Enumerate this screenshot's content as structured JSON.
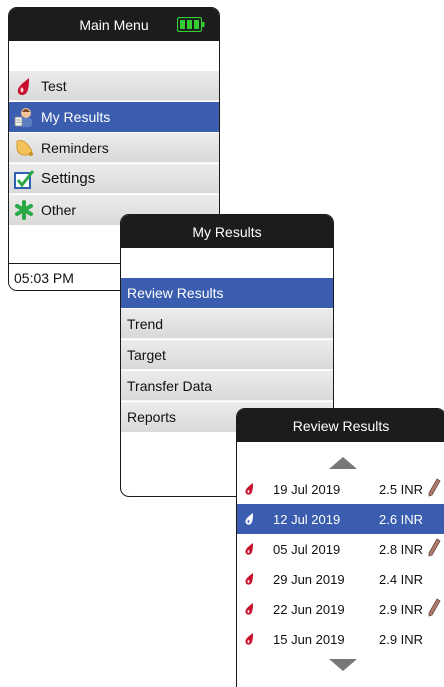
{
  "main_menu": {
    "title": "Main Menu",
    "battery_icon": "battery-full-icon",
    "items": [
      {
        "label": "Test",
        "icon": "blood-drop-icon"
      },
      {
        "label": "My Results",
        "icon": "user-results-icon"
      },
      {
        "label": "Reminders",
        "icon": "bell-icon"
      },
      {
        "label": "Settings",
        "icon": "checkbox-icon"
      },
      {
        "label": "Other",
        "icon": "star-icon"
      }
    ],
    "selected_index": 1,
    "time": "05:03 PM"
  },
  "my_results": {
    "title": "My Results",
    "items": [
      {
        "label": "Review Results"
      },
      {
        "label": "Trend"
      },
      {
        "label": "Target"
      },
      {
        "label": "Transfer Data"
      },
      {
        "label": "Reports"
      }
    ],
    "selected_index": 0
  },
  "review_results": {
    "title": "Review Results",
    "rows": [
      {
        "date": "19 Jul 2019",
        "value": "2.5 INR",
        "has_note": true
      },
      {
        "date": "12 Jul 2019",
        "value": "2.6 INR",
        "has_note": false
      },
      {
        "date": "05 Jul 2019",
        "value": "2.8 INR",
        "has_note": true
      },
      {
        "date": "29 Jun 2019",
        "value": "2.4 INR",
        "has_note": false
      },
      {
        "date": "22 Jun 2019",
        "value": "2.9 INR",
        "has_note": true
      },
      {
        "date": "15 Jun 2019",
        "value": "2.9 INR",
        "has_note": false
      }
    ],
    "selected_index": 1
  },
  "colors": {
    "selection": "#3a5db0",
    "title_bar": "#1c1c1c",
    "drop_red": "#c8102e",
    "battery_green": "#33cc33"
  }
}
